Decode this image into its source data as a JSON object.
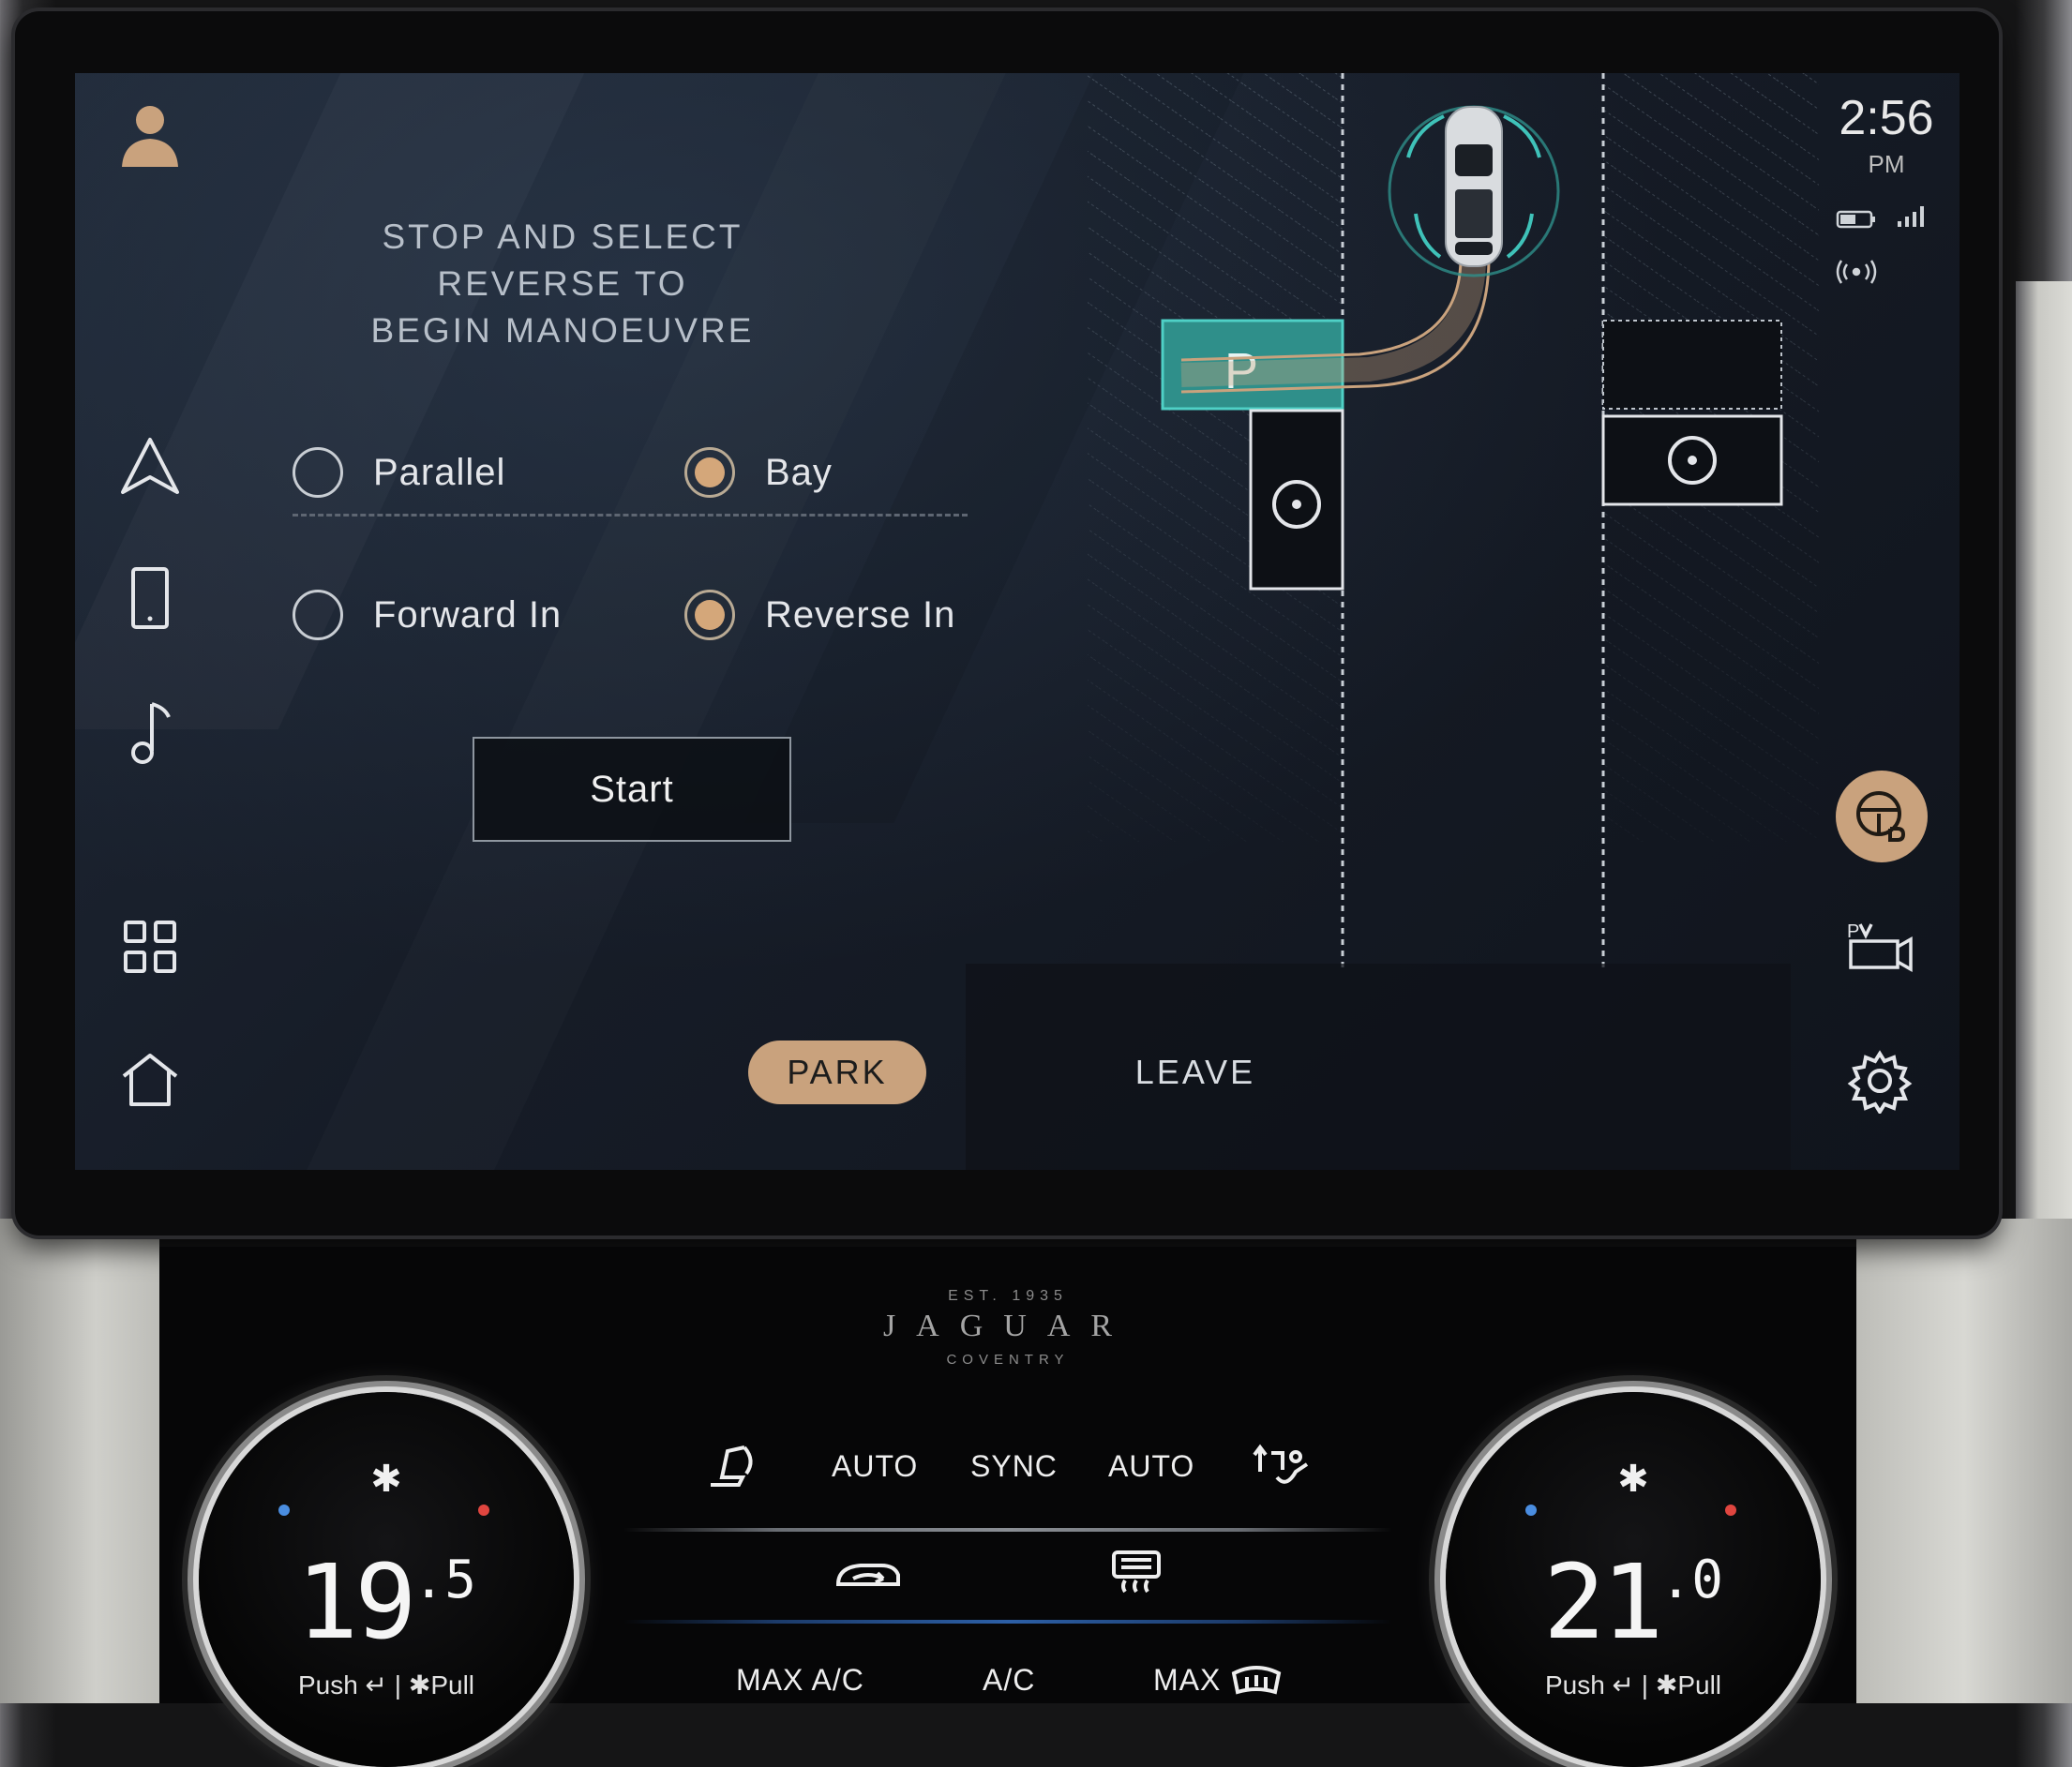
{
  "nav": {
    "items": [
      "profile-icon",
      "navigation-icon",
      "phone-icon",
      "media-icon",
      "apps-icon",
      "home-icon"
    ]
  },
  "status": {
    "time": "2:56",
    "ampm": "PM",
    "icons": [
      "battery-icon",
      "signal-icon",
      "wireless-icon"
    ]
  },
  "park_assist": {
    "message_line1": "STOP AND SELECT REVERSE TO",
    "message_line2": "BEGIN MANOEUVRE",
    "options": [
      {
        "label": "Parallel",
        "selected": false
      },
      {
        "label": "Bay",
        "selected": true
      },
      {
        "label": "Forward In",
        "selected": false
      },
      {
        "label": "Reverse In",
        "selected": true
      }
    ],
    "start_label": "Start",
    "diagram_bay_label": "P"
  },
  "modes": {
    "park": "PARK",
    "leave": "LEAVE",
    "active": "PARK"
  },
  "side_actions": [
    "park-assist-icon",
    "parking-camera-icon",
    "settings-icon"
  ],
  "colors": {
    "accent": "#c9a27d",
    "teal": "#3aa6a0",
    "screen_bg": "#161c27"
  },
  "brand": {
    "est": "EST. 1935",
    "name": "JAGUAR",
    "city": "COVENTRY"
  },
  "climate": {
    "left_dial": {
      "temp_main": "19",
      "temp_decimal": ".5",
      "push_label": "Push",
      "pull_label": "Pull"
    },
    "right_dial": {
      "temp_main": "21",
      "temp_decimal": ".0",
      "push_label": "Push",
      "pull_label": "Pull"
    },
    "top_row": [
      "AUTO",
      "SYNC",
      "AUTO"
    ],
    "bottom_row": [
      "MAX A/C",
      "A/C",
      "MAX"
    ]
  }
}
